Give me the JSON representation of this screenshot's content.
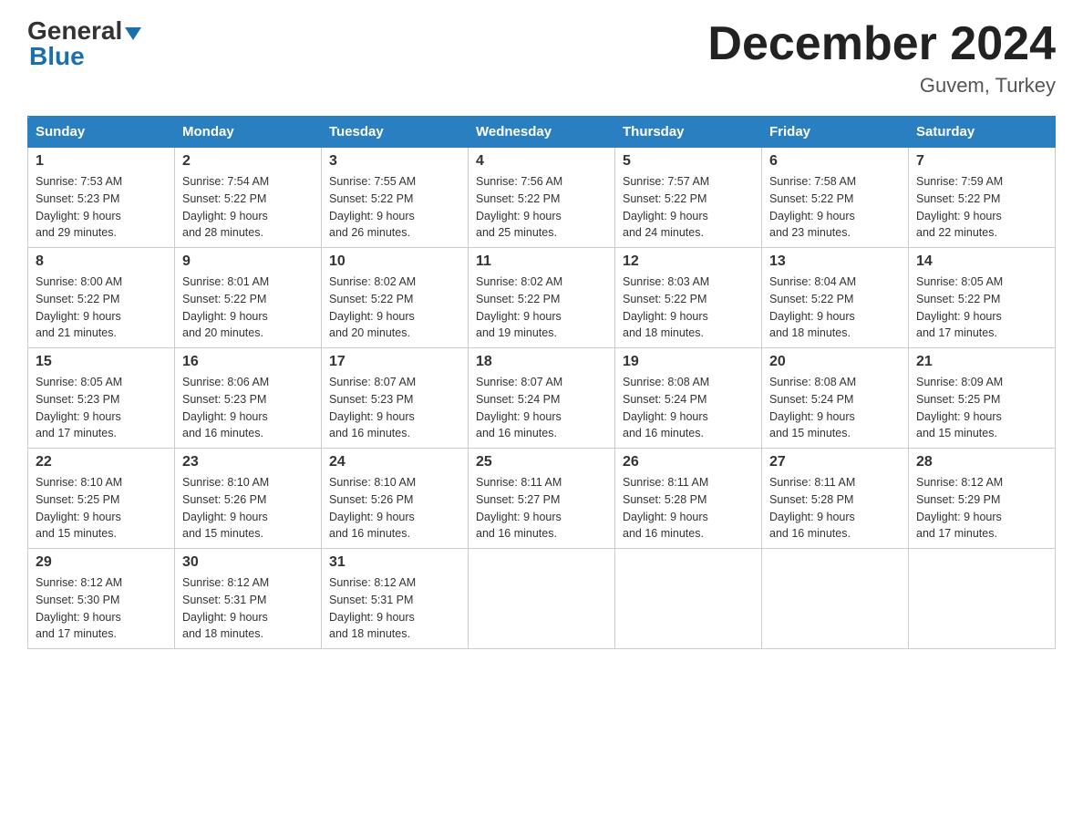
{
  "header": {
    "logo_general": "General",
    "logo_blue": "Blue",
    "month_title": "December 2024",
    "location": "Guvem, Turkey"
  },
  "columns": [
    "Sunday",
    "Monday",
    "Tuesday",
    "Wednesday",
    "Thursday",
    "Friday",
    "Saturday"
  ],
  "weeks": [
    [
      {
        "day": "1",
        "sunrise": "7:53 AM",
        "sunset": "5:23 PM",
        "daylight": "9 hours and 29 minutes."
      },
      {
        "day": "2",
        "sunrise": "7:54 AM",
        "sunset": "5:22 PM",
        "daylight": "9 hours and 28 minutes."
      },
      {
        "day": "3",
        "sunrise": "7:55 AM",
        "sunset": "5:22 PM",
        "daylight": "9 hours and 26 minutes."
      },
      {
        "day": "4",
        "sunrise": "7:56 AM",
        "sunset": "5:22 PM",
        "daylight": "9 hours and 25 minutes."
      },
      {
        "day": "5",
        "sunrise": "7:57 AM",
        "sunset": "5:22 PM",
        "daylight": "9 hours and 24 minutes."
      },
      {
        "day": "6",
        "sunrise": "7:58 AM",
        "sunset": "5:22 PM",
        "daylight": "9 hours and 23 minutes."
      },
      {
        "day": "7",
        "sunrise": "7:59 AM",
        "sunset": "5:22 PM",
        "daylight": "9 hours and 22 minutes."
      }
    ],
    [
      {
        "day": "8",
        "sunrise": "8:00 AM",
        "sunset": "5:22 PM",
        "daylight": "9 hours and 21 minutes."
      },
      {
        "day": "9",
        "sunrise": "8:01 AM",
        "sunset": "5:22 PM",
        "daylight": "9 hours and 20 minutes."
      },
      {
        "day": "10",
        "sunrise": "8:02 AM",
        "sunset": "5:22 PM",
        "daylight": "9 hours and 20 minutes."
      },
      {
        "day": "11",
        "sunrise": "8:02 AM",
        "sunset": "5:22 PM",
        "daylight": "9 hours and 19 minutes."
      },
      {
        "day": "12",
        "sunrise": "8:03 AM",
        "sunset": "5:22 PM",
        "daylight": "9 hours and 18 minutes."
      },
      {
        "day": "13",
        "sunrise": "8:04 AM",
        "sunset": "5:22 PM",
        "daylight": "9 hours and 18 minutes."
      },
      {
        "day": "14",
        "sunrise": "8:05 AM",
        "sunset": "5:22 PM",
        "daylight": "9 hours and 17 minutes."
      }
    ],
    [
      {
        "day": "15",
        "sunrise": "8:05 AM",
        "sunset": "5:23 PM",
        "daylight": "9 hours and 17 minutes."
      },
      {
        "day": "16",
        "sunrise": "8:06 AM",
        "sunset": "5:23 PM",
        "daylight": "9 hours and 16 minutes."
      },
      {
        "day": "17",
        "sunrise": "8:07 AM",
        "sunset": "5:23 PM",
        "daylight": "9 hours and 16 minutes."
      },
      {
        "day": "18",
        "sunrise": "8:07 AM",
        "sunset": "5:24 PM",
        "daylight": "9 hours and 16 minutes."
      },
      {
        "day": "19",
        "sunrise": "8:08 AM",
        "sunset": "5:24 PM",
        "daylight": "9 hours and 16 minutes."
      },
      {
        "day": "20",
        "sunrise": "8:08 AM",
        "sunset": "5:24 PM",
        "daylight": "9 hours and 15 minutes."
      },
      {
        "day": "21",
        "sunrise": "8:09 AM",
        "sunset": "5:25 PM",
        "daylight": "9 hours and 15 minutes."
      }
    ],
    [
      {
        "day": "22",
        "sunrise": "8:10 AM",
        "sunset": "5:25 PM",
        "daylight": "9 hours and 15 minutes."
      },
      {
        "day": "23",
        "sunrise": "8:10 AM",
        "sunset": "5:26 PM",
        "daylight": "9 hours and 15 minutes."
      },
      {
        "day": "24",
        "sunrise": "8:10 AM",
        "sunset": "5:26 PM",
        "daylight": "9 hours and 16 minutes."
      },
      {
        "day": "25",
        "sunrise": "8:11 AM",
        "sunset": "5:27 PM",
        "daylight": "9 hours and 16 minutes."
      },
      {
        "day": "26",
        "sunrise": "8:11 AM",
        "sunset": "5:28 PM",
        "daylight": "9 hours and 16 minutes."
      },
      {
        "day": "27",
        "sunrise": "8:11 AM",
        "sunset": "5:28 PM",
        "daylight": "9 hours and 16 minutes."
      },
      {
        "day": "28",
        "sunrise": "8:12 AM",
        "sunset": "5:29 PM",
        "daylight": "9 hours and 17 minutes."
      }
    ],
    [
      {
        "day": "29",
        "sunrise": "8:12 AM",
        "sunset": "5:30 PM",
        "daylight": "9 hours and 17 minutes."
      },
      {
        "day": "30",
        "sunrise": "8:12 AM",
        "sunset": "5:31 PM",
        "daylight": "9 hours and 18 minutes."
      },
      {
        "day": "31",
        "sunrise": "8:12 AM",
        "sunset": "5:31 PM",
        "daylight": "9 hours and 18 minutes."
      },
      null,
      null,
      null,
      null
    ]
  ],
  "labels": {
    "sunrise": "Sunrise:",
    "sunset": "Sunset:",
    "daylight": "Daylight:"
  }
}
